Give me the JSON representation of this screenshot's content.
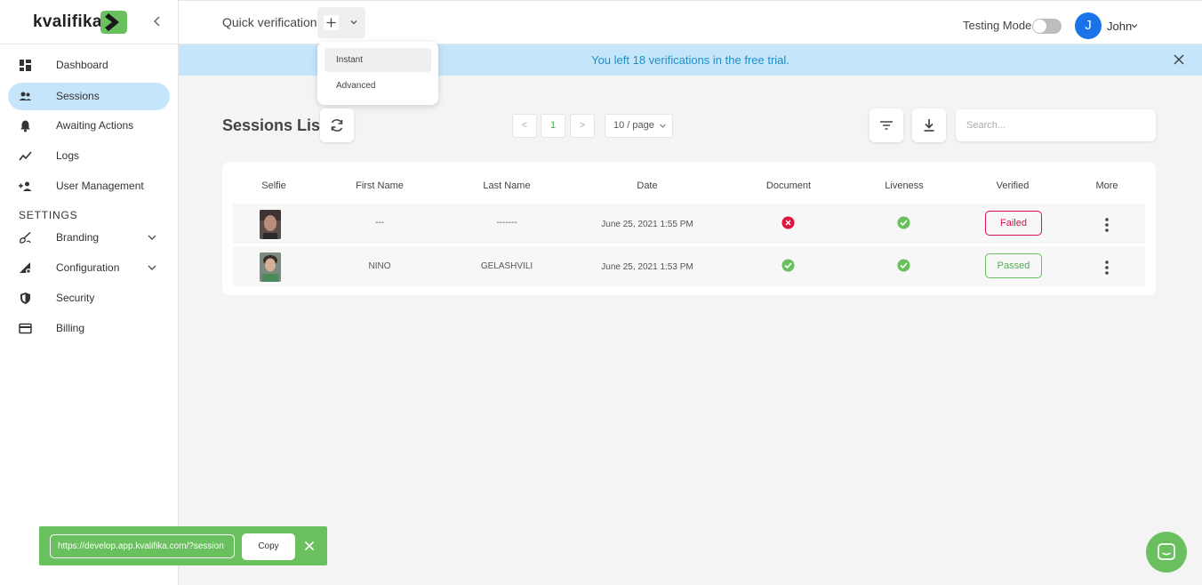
{
  "brand": {
    "name": "kvalifika",
    "accent": "#6abf5e"
  },
  "sidebar": {
    "collapse_icon": "chevron-left-icon",
    "items": [
      {
        "label": "Dashboard",
        "icon": "dashboard-icon"
      },
      {
        "label": "Sessions",
        "icon": "people-icon",
        "active": true
      },
      {
        "label": "Awaiting Actions",
        "icon": "bell-icon"
      },
      {
        "label": "Logs",
        "icon": "line-chart-icon"
      },
      {
        "label": "User Management",
        "icon": "add-user-icon"
      }
    ],
    "settings_heading": "SETTINGS",
    "settings_items": [
      {
        "label": "Branding",
        "icon": "brush-icon",
        "expandable": true
      },
      {
        "label": "Configuration",
        "icon": "settings-triangle-icon",
        "expandable": true
      },
      {
        "label": "Security",
        "icon": "shield-icon"
      },
      {
        "label": "Billing",
        "icon": "credit-card-icon"
      }
    ]
  },
  "topbar": {
    "quick_verification_label": "Quick verification",
    "testing_mode_label": "Testing Mode",
    "testing_mode_on": false,
    "avatar_initial": "J",
    "user_name": "John"
  },
  "quick_menu": {
    "items": [
      "Instant",
      "Advanced"
    ]
  },
  "banner": {
    "text": "You left 18 verifications in the free trial."
  },
  "sessions": {
    "title": "Sessions List",
    "pagination": {
      "prev": "<",
      "current": "1",
      "next": ">",
      "page_size": "10 / page"
    },
    "search_placeholder": "Search...",
    "columns": [
      "Selfie",
      "First Name",
      "Last Name",
      "Date",
      "Document",
      "Liveness",
      "Verified",
      "More"
    ],
    "rows": [
      {
        "first_name": "---",
        "last_name": "-------",
        "date": "June 25, 2021 1:55 PM",
        "document": "failed",
        "liveness": "passed",
        "verified": "Failed"
      },
      {
        "first_name": "NINO",
        "last_name": "GELASHVILI",
        "date": "June 25, 2021 1:53 PM",
        "document": "passed",
        "liveness": "passed",
        "verified": "Passed"
      }
    ]
  },
  "toast": {
    "url": "https://develop.app.kvalifika.com/?session",
    "copy_label": "Copy"
  },
  "colors": {
    "banner_bg": "#c5e5fa",
    "banner_text": "#1e8fc8",
    "failed": "#d9134c",
    "passed": "#6abf5e",
    "avatar": "#1a73e8"
  }
}
